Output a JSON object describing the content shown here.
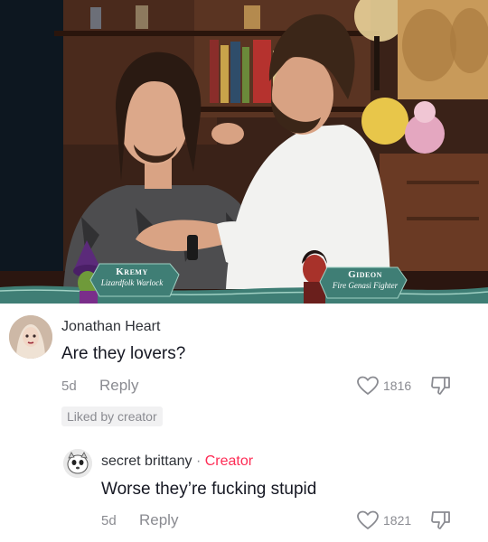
{
  "video": {
    "player_left": {
      "name": "Kremy",
      "class": "Lizardfolk Warlock"
    },
    "player_right": {
      "name": "Gideon",
      "class": "Fire Genasi Fighter"
    }
  },
  "comments": [
    {
      "username": "Jonathan Heart",
      "text": "Are they lovers?",
      "age": "5d",
      "reply_label": "Reply",
      "like_count": "1816",
      "liked_by": "Liked by creator",
      "avatar_icon": "avatar-icon"
    },
    {
      "username": "secret brittany",
      "separator": "·",
      "creator_label": "Creator",
      "text": "Worse they’re fucking stupid",
      "age": "5d",
      "reply_label": "Reply",
      "like_count": "1821",
      "avatar_icon": "avatar-icon"
    }
  ],
  "watermark": "",
  "colors": {
    "creator_accent": "#fe2c55",
    "muted_text": "#8a8b91",
    "nameplate_teal": "#3f7e75"
  },
  "icons": [
    "heart-outline-icon",
    "thumbs-down-icon"
  ]
}
